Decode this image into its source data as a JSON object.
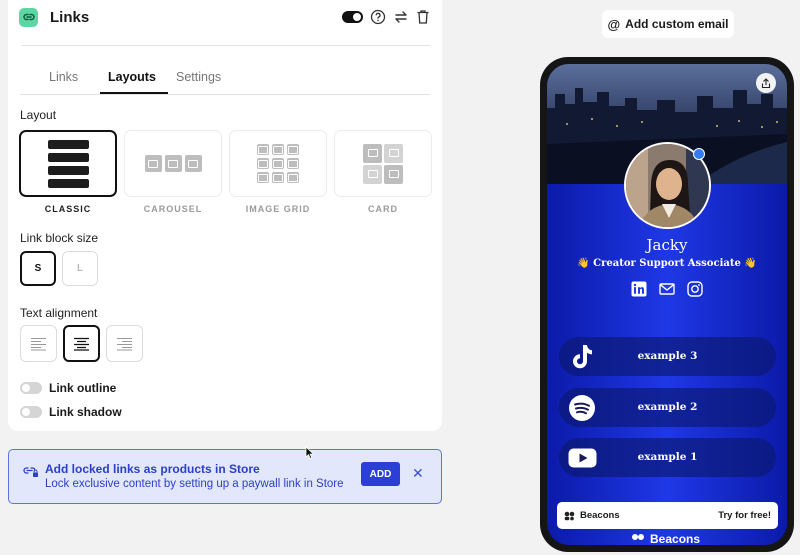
{
  "header": {
    "title": "Links"
  },
  "tabs": [
    {
      "label": "Links"
    },
    {
      "label": "Layouts",
      "active": true
    },
    {
      "label": "Settings"
    }
  ],
  "layout": {
    "label": "Layout",
    "options": [
      "CLASSIC",
      "CAROUSEL",
      "IMAGE GRID",
      "CARD"
    ],
    "selected": "CLASSIC"
  },
  "link_block_size": {
    "label": "Link block size",
    "options": [
      "S",
      "L"
    ],
    "selected": "S"
  },
  "text_alignment": {
    "label": "Text alignment",
    "options": [
      "left",
      "center",
      "right"
    ],
    "selected": "center"
  },
  "toggles": {
    "outline": "Link outline",
    "shadow": "Link shadow"
  },
  "banner": {
    "title": "Add locked links as products in Store",
    "subtitle": "Lock exclusive content by setting up a paywall link in Store",
    "add_label": "ADD",
    "close_glyph": "✕",
    "color": "#2b3fc7"
  },
  "preview": {
    "custom_email_label": "Add custom email",
    "profile": {
      "name": "Jacky",
      "title": "👋 Creator Support Associate 👋"
    },
    "links": [
      {
        "label": "example 3",
        "icon": "tiktok-icon"
      },
      {
        "label": "example 2",
        "icon": "spotify-icon"
      },
      {
        "label": "example 1",
        "icon": "youtube-icon"
      }
    ],
    "footer": {
      "brand": "Beacons",
      "cta": "Try for free!"
    },
    "background_color": "#1f38e6"
  }
}
